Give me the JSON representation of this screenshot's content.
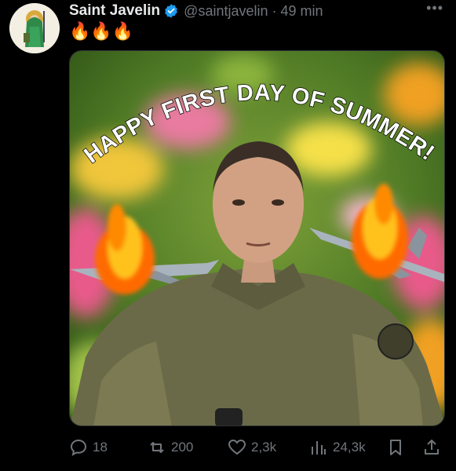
{
  "tweet": {
    "display_name": "Saint Javelin",
    "handle": "@saintjavelin",
    "separator": "·",
    "time": "49 min",
    "text": "🔥🔥🔥",
    "more": "•••"
  },
  "media": {
    "caption": "HAPPY FIRST DAY OF SUMMER!!!"
  },
  "actions": {
    "replies": "18",
    "reposts": "200",
    "likes": "2,3k",
    "views": "24,3k"
  },
  "colors": {
    "verified": "#1d9bf0",
    "muted": "#71767b",
    "text": "#e7e9ea"
  },
  "icons": [
    "reply-icon",
    "repost-icon",
    "like-icon",
    "views-icon",
    "bookmark-icon",
    "share-icon",
    "verified-icon",
    "more-icon"
  ]
}
